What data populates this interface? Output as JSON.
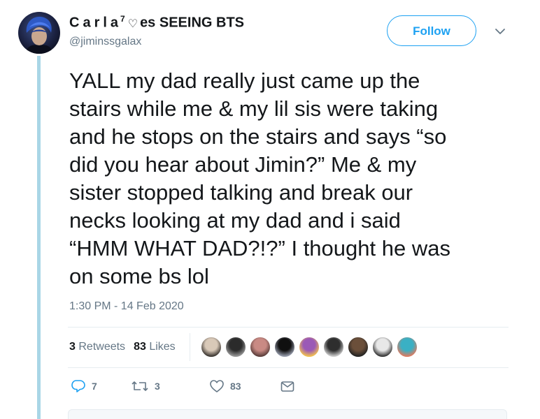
{
  "author": {
    "name_spaced": "Carla",
    "name_superscript": "7",
    "name_heart": "♡",
    "name_rest": "es SEEING BTS",
    "handle": "@jiminssgalax"
  },
  "follow_label": "Follow",
  "tweet": {
    "lines": [
      "YALL my dad really just came up the",
      "stairs while me & my lil sis were taking",
      "and he stops on the stairs and says “so",
      "did you hear about Jimin?” Me & my",
      "sister stopped talking and break our",
      "necks looking at my dad and i said",
      "“HMM WHAT DAD?!?” I thought he was",
      "on some bs lol"
    ],
    "timestamp": "1:30 PM - 14 Feb 2020"
  },
  "stats": {
    "retweets_count": "3",
    "retweets_label": "Retweets",
    "likes_count": "83",
    "likes_label": "Likes"
  },
  "likers": [
    {
      "colors": [
        "#d9c9b8",
        "#3a3530"
      ]
    },
    {
      "colors": [
        "#2b2b2b",
        "#9a9a9a"
      ]
    },
    {
      "colors": [
        "#c98a84",
        "#5a3d3a"
      ]
    },
    {
      "colors": [
        "#101010",
        "#9aa0b0"
      ]
    },
    {
      "colors": [
        "#9b59b6",
        "#f2c14e"
      ]
    },
    {
      "colors": [
        "#2e2e2e",
        "#d0d0d0"
      ]
    },
    {
      "colors": [
        "#6b4f3a",
        "#222222"
      ]
    },
    {
      "colors": [
        "#e8e8e8",
        "#333333"
      ]
    },
    {
      "colors": [
        "#3ab0c4",
        "#e07a5f"
      ]
    }
  ],
  "actions": {
    "reply_count": "7",
    "retweet_count": "3",
    "like_count": "83"
  },
  "colors": {
    "accent": "#1da1f2",
    "thread_line": "#a9d6e6",
    "secondary_text": "#657786",
    "divider": "#e6ecf0"
  },
  "icons": {
    "reply": "reply-icon",
    "retweet": "retweet-icon",
    "like": "heart-icon",
    "message": "envelope-icon",
    "more": "chevron-down-icon"
  }
}
